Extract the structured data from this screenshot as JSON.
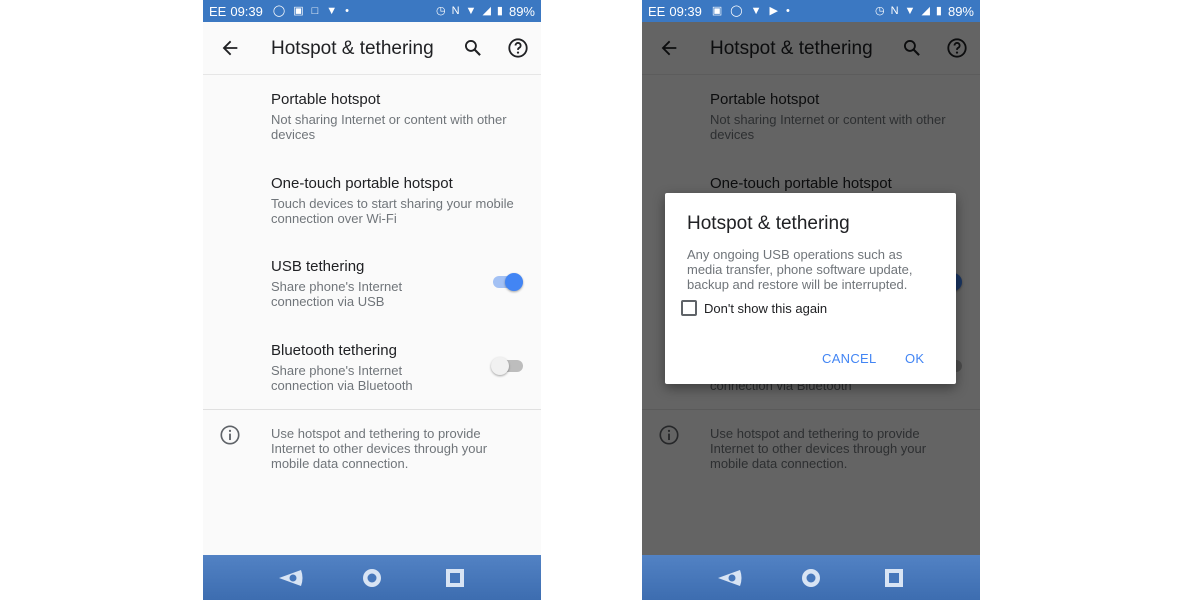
{
  "status_left": {
    "carrier": "EE",
    "time": "09:39",
    "battery": "89%"
  },
  "status_right": {
    "carrier": "EE",
    "time": "09:39",
    "battery": "89%"
  },
  "app_bar": {
    "title": "Hotspot & tethering"
  },
  "settings": [
    {
      "title": "Portable hotspot",
      "subtitle": "Not sharing Internet or content with other devices"
    },
    {
      "title": "One-touch portable hotspot",
      "subtitle": "Touch devices to start sharing your mobile connection over Wi-Fi"
    },
    {
      "title": "USB tethering",
      "subtitle": "Share phone's Internet connection via USB",
      "toggle": "on"
    },
    {
      "title": "Bluetooth tethering",
      "subtitle": "Share phone's Internet connection via Bluetooth",
      "toggle": "off"
    }
  ],
  "info_text": "Use hotspot and tethering to provide Internet to other devices through your mobile data connection.",
  "dialog": {
    "title": "Hotspot & tethering",
    "body": "Any ongoing USB operations such as media transfer, phone software update, backup and restore will be interrupted.",
    "checkbox_label": "Don't show this again",
    "checkbox_checked": false,
    "cancel_label": "CANCEL",
    "ok_label": "OK"
  },
  "colors": {
    "status_bar": "#3b78c2",
    "accent": "#4285f4",
    "nav_bar": "#4677bb"
  },
  "icons": [
    "alarm-icon",
    "nfc-icon",
    "wifi-icon",
    "signal-icon",
    "battery-icon",
    "back-arrow-icon",
    "search-icon",
    "help-icon",
    "info-icon",
    "nav-back-icon",
    "nav-home-icon",
    "nav-recents-icon"
  ]
}
